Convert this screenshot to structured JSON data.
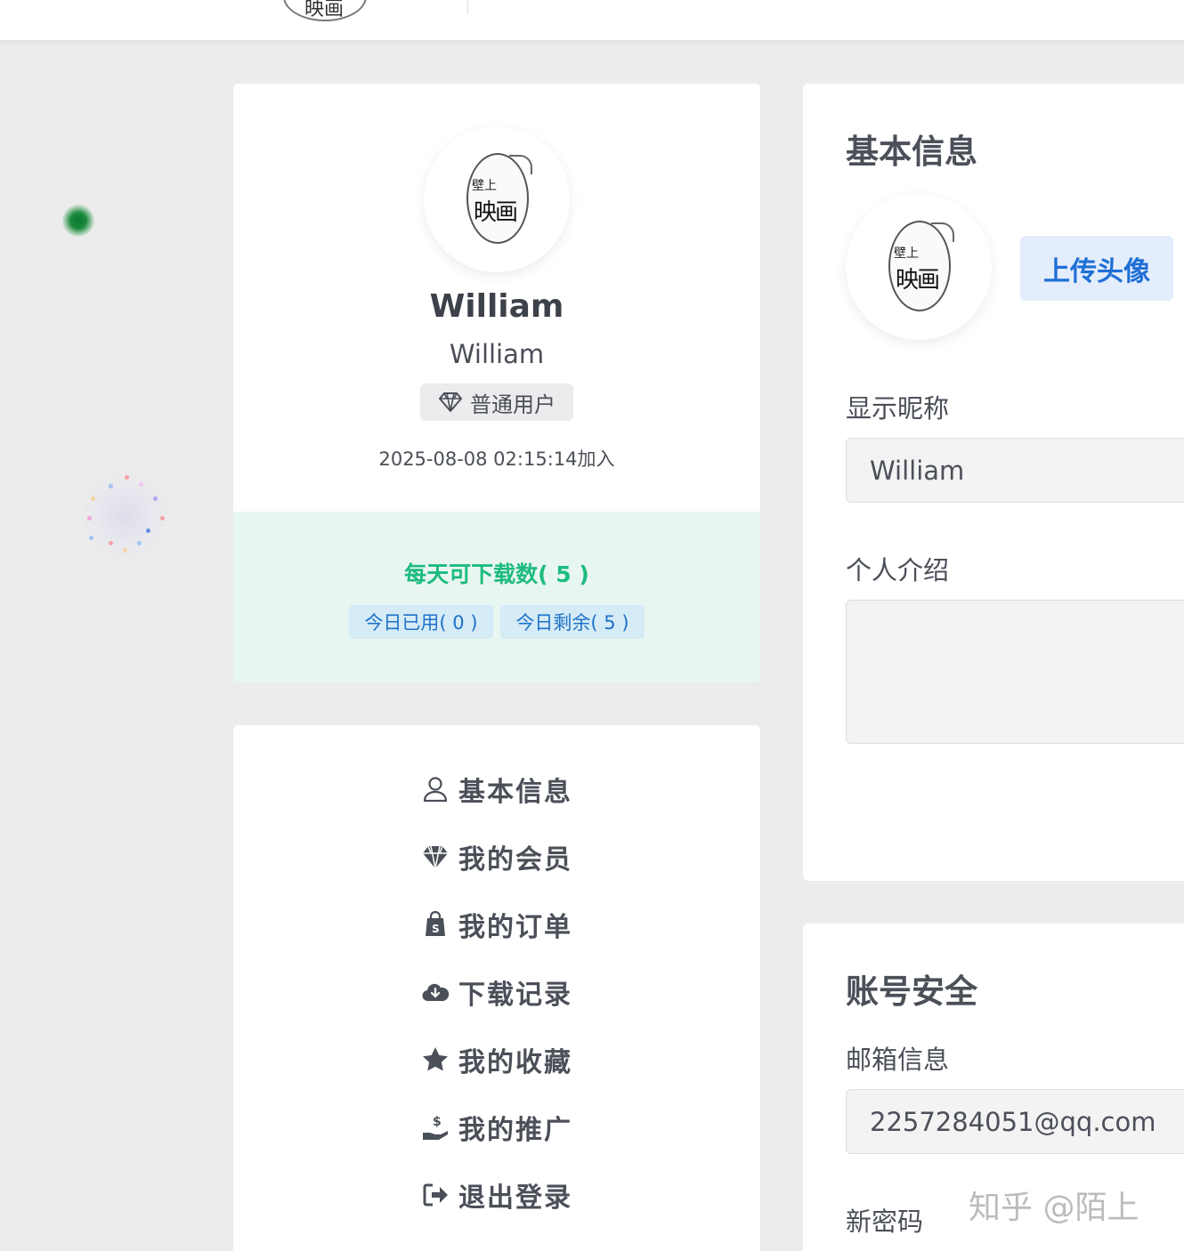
{
  "header": {
    "logo_text": "映画"
  },
  "profile": {
    "avatar_text_small": "壁上",
    "avatar_text_main": "映画",
    "display_name": "William",
    "username": "William",
    "role_label": "普通用户",
    "joined_text": "2025-08-08 02:15:14加入",
    "quota": {
      "daily_label": "每天可下载数( 5 )",
      "used_label": "今日已用( 0 )",
      "remaining_label": "今日剩余( 5 )"
    }
  },
  "menu": {
    "items": [
      {
        "label": "基本信息",
        "icon": "user-icon"
      },
      {
        "label": "我的会员",
        "icon": "diamond-icon"
      },
      {
        "label": "我的订单",
        "icon": "shopping-bag-icon"
      },
      {
        "label": "下载记录",
        "icon": "cloud-download-icon"
      },
      {
        "label": "我的收藏",
        "icon": "star-icon"
      },
      {
        "label": "我的推广",
        "icon": "hand-dollar-icon"
      },
      {
        "label": "退出登录",
        "icon": "sign-out-icon"
      }
    ]
  },
  "basic_info": {
    "title": "基本信息",
    "upload_avatar_label": "上传头像",
    "nickname_label": "显示昵称",
    "nickname_value": "William",
    "bio_label": "个人介绍",
    "bio_value": ""
  },
  "security": {
    "title": "账号安全",
    "email_label": "邮箱信息",
    "email_value": "2257284051@qq.com",
    "new_password_label": "新密码"
  },
  "watermark": "知乎 @陌上",
  "colors": {
    "accent_green": "#1dbb7f",
    "accent_blue": "#1f6fd6",
    "background": "#ececec"
  }
}
